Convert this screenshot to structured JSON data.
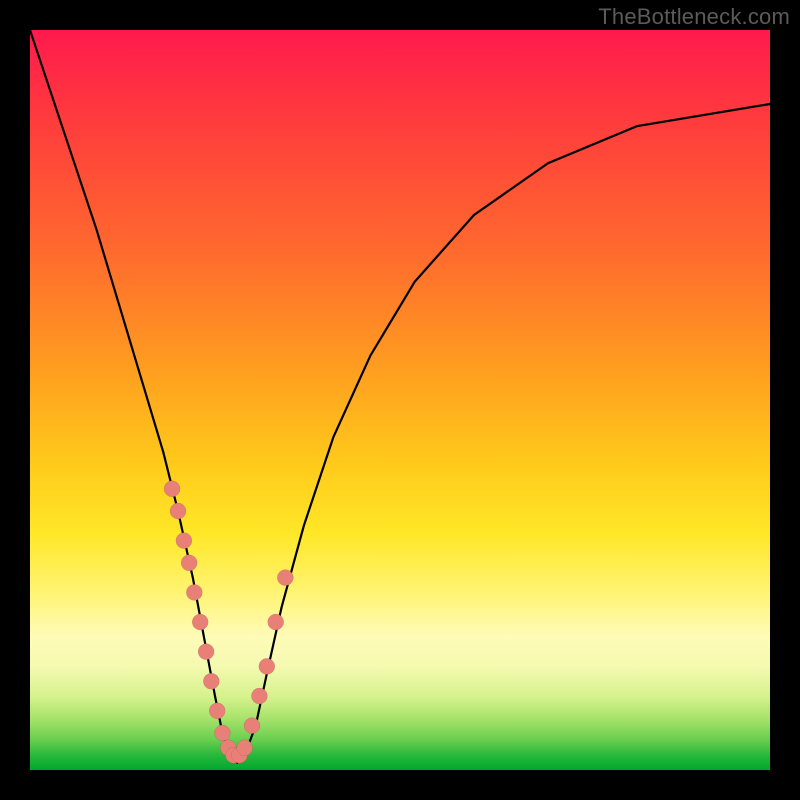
{
  "watermark": "TheBottleneck.com",
  "chart_data": {
    "type": "line",
    "title": "",
    "xlabel": "",
    "ylabel": "",
    "xlim": [
      0,
      100
    ],
    "ylim": [
      0,
      100
    ],
    "legend": false,
    "grid": false,
    "series": [
      {
        "name": "bottleneck-curve",
        "x": [
          0,
          3,
          6,
          9,
          12,
          15,
          18,
          20,
          22,
          23.5,
          25,
          26,
          27,
          28,
          29,
          30.5,
          32,
          34,
          37,
          41,
          46,
          52,
          60,
          70,
          82,
          100
        ],
        "y": [
          100,
          91,
          82,
          73,
          63,
          53,
          43,
          35,
          26,
          18,
          10,
          5,
          2,
          1,
          2,
          6,
          13,
          22,
          33,
          45,
          56,
          66,
          75,
          82,
          87,
          90
        ]
      }
    ],
    "markers": {
      "name": "highlighted-points",
      "x": [
        19.2,
        20.0,
        20.8,
        21.5,
        22.2,
        23.0,
        23.8,
        24.5,
        25.3,
        26.0,
        26.8,
        27.5,
        28.3,
        29.0,
        30.0,
        31.0,
        32.0,
        33.2,
        34.5
      ],
      "y": [
        38,
        35,
        31,
        28,
        24,
        20,
        16,
        12,
        8,
        5,
        3,
        2,
        2,
        3,
        6,
        10,
        14,
        20,
        26
      ]
    },
    "background_gradient": {
      "top": "#ff1a4d",
      "upper_mid": "#ff9b20",
      "mid": "#ffe727",
      "lower": "#a8e36b",
      "bottom": "#00a82e"
    }
  }
}
